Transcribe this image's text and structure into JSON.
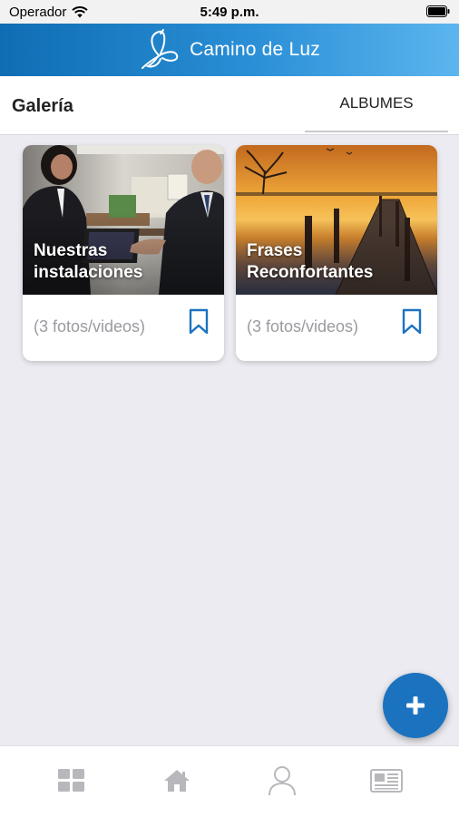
{
  "status_bar": {
    "carrier": "Operador",
    "time": "5:49 p.m."
  },
  "header": {
    "brand": "Camino de Luz",
    "logo_icon": "butterfly-icon"
  },
  "page": {
    "title": "Galería",
    "tab_label": "ALBUMES"
  },
  "albums": [
    {
      "title_line1": "Nuestras",
      "title_line2": "instalaciones",
      "count": "(3 fotos/videos)"
    },
    {
      "title_line1": "Frases",
      "title_line2": "Reconfortantes",
      "count": "(3 fotos/videos)"
    }
  ],
  "bottom_nav": {
    "items": [
      "grid-icon",
      "home-icon",
      "user-icon",
      "news-icon"
    ]
  },
  "colors": {
    "accent": "#1b73c0",
    "header_start": "#0f6db3",
    "header_end": "#5cb5ee"
  }
}
